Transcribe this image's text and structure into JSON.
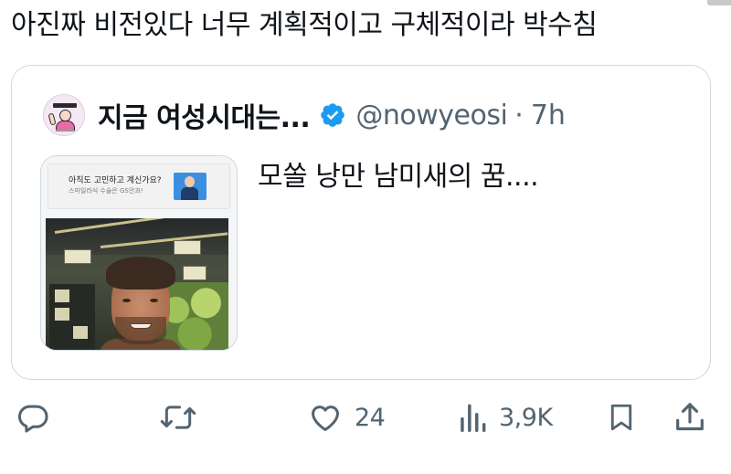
{
  "tweet": {
    "text": "아진짜 비전있다 너무 계획적이고 구체적이라 박수침"
  },
  "quote": {
    "display_name": "지금 여성시대는...",
    "handle": "@nowyeosi",
    "separator": "·",
    "time": "7h",
    "text": "모쏠 낭만 남미새의 꿈....",
    "media": {
      "ad_line1": "아직도 고민하고 계신가요?",
      "ad_line2": "스마일라식 수술은 GS안과!"
    }
  },
  "actions": {
    "reply": {
      "icon": "reply-icon"
    },
    "retweet": {
      "icon": "retweet-icon"
    },
    "like": {
      "icon": "heart-icon",
      "count": "24"
    },
    "views": {
      "icon": "views-icon",
      "count": "3,9K"
    },
    "bookmark": {
      "icon": "bookmark-icon"
    },
    "share": {
      "icon": "share-icon"
    }
  },
  "colors": {
    "text": "#0f1419",
    "secondary": "#536471",
    "border": "#cfd9de",
    "verified": "#1d9bf0"
  }
}
